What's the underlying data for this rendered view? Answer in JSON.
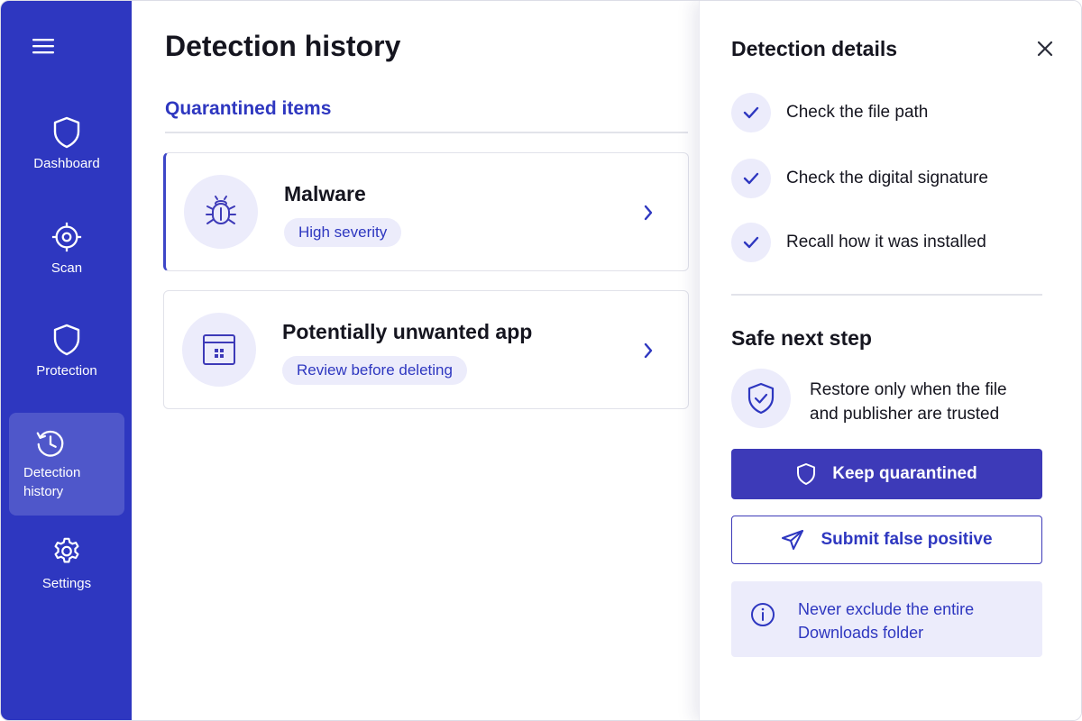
{
  "sidebar": {
    "items": [
      {
        "label": "Dashboard",
        "icon": "shield-icon"
      },
      {
        "label": "Scan",
        "icon": "target-icon"
      },
      {
        "label": "Protection",
        "icon": "shield-icon"
      },
      {
        "label": "Detection history",
        "icon": "history-icon",
        "active": true
      },
      {
        "label": "Settings",
        "icon": "gear-icon"
      }
    ]
  },
  "main": {
    "title": "Detection history",
    "section_title": "Quarantined items",
    "cards": [
      {
        "title": "Malware",
        "badge": "High severity",
        "icon": "bug-icon",
        "selected": true
      },
      {
        "title": "Potentially unwanted app",
        "badge": "Review before deleting",
        "icon": "app-window-icon"
      }
    ]
  },
  "panel": {
    "title": "Detection details",
    "checks": [
      "Check the file path",
      "Check the digital signature",
      "Recall how it was installed"
    ],
    "next_step_title": "Safe next step",
    "restore_text": "Restore only when the file and publisher are trusted",
    "primary_button": "Keep quarantined",
    "secondary_button": "Submit false positive",
    "info_text": "Never exclude the entire Downloads folder"
  },
  "colors": {
    "sidebar": "#2e37c0",
    "accent": "#3d3ab8",
    "tint": "#ececfb"
  }
}
